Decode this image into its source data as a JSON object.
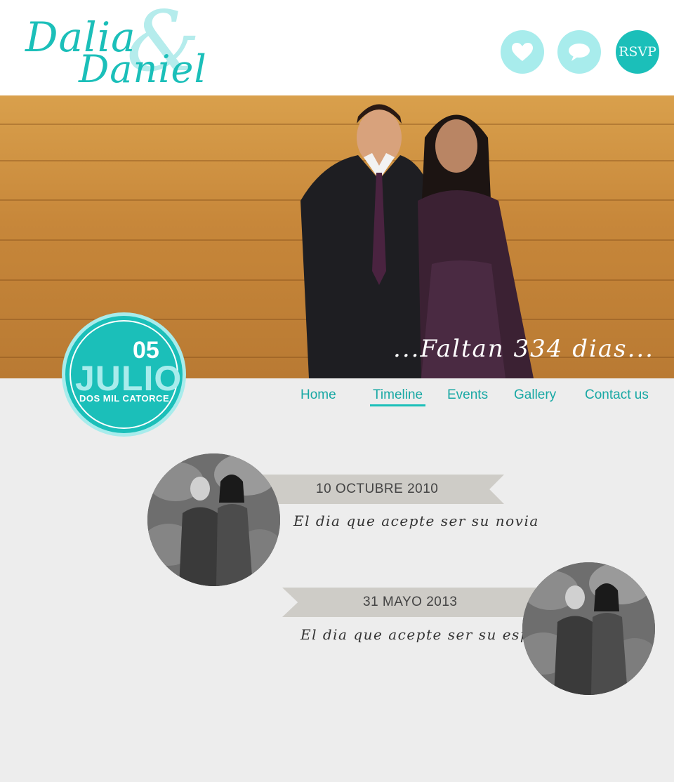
{
  "brand": {
    "name_first": "Dalia",
    "ampersand": "&",
    "name_second": "Daniel"
  },
  "header_buttons": {
    "love_icon": "heart-icon",
    "chat_icon": "speech-bubble-icon",
    "rsvp_label": "RSVP"
  },
  "hero": {
    "countdown": "...Faltan 334 dias..."
  },
  "date_badge": {
    "day": "05",
    "month": "JULIO",
    "year": "DOS MIL CATORCE"
  },
  "nav": {
    "items": [
      "Home",
      "Timeline",
      "Events",
      "Gallery",
      "Contact us"
    ],
    "active": "Timeline"
  },
  "timeline": [
    {
      "date": "10 OCTUBRE 2010",
      "caption": "El dia que acepte ser su novia"
    },
    {
      "date": "31 MAYO 2013",
      "caption": "El dia que acepte ser su esposa"
    }
  ],
  "colors": {
    "accent": "#1bbfb9",
    "accent_light": "#a8ecec",
    "ribbon": "#ceccc7",
    "background": "#ededed"
  }
}
